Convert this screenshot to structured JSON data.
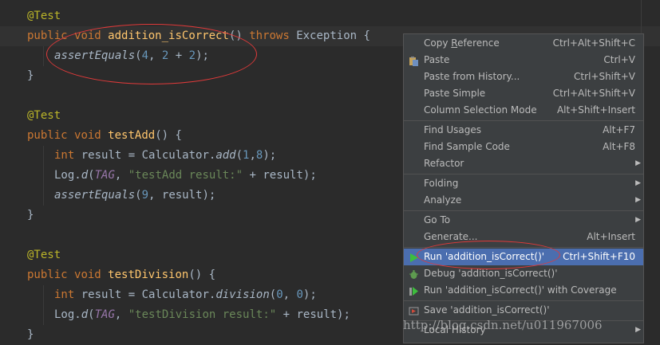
{
  "editor": {
    "lines": [
      {
        "ann": "@Test"
      },
      {
        "kw1": "public",
        "kw2": "void",
        "name": "addition_isCorrect",
        "paren": "()",
        "throws": "throws",
        "exc": "Exception {"
      },
      {
        "call": "assertEquals",
        "open": "(",
        "n1": "4",
        "sep1": ", ",
        "n2": "2",
        "plus": " + ",
        "n3": "2",
        "close": ");"
      },
      {
        "text": "}"
      },
      {
        "ann": "@Test"
      },
      {
        "kw1": "public",
        "kw2": "void",
        "name": "testAdd",
        "rest": "() {"
      },
      {
        "type": "int",
        "pre": "result = Calculator.",
        "call": "add",
        "open": "(",
        "n1": "1",
        "sep": ",",
        "n2": "8",
        "close": ");"
      },
      {
        "pre": "Log.",
        "call": "d",
        "open": "(",
        "const": "TAG",
        "sep": ", ",
        "str": "\"testAdd result:\"",
        "rest": " + result);"
      },
      {
        "call": "assertEquals",
        "open": "(",
        "n1": "9",
        "rest": ", result);"
      },
      {
        "text": "}"
      },
      {
        "ann": "@Test"
      },
      {
        "kw1": "public",
        "kw2": "void",
        "name": "testDivision",
        "rest": "() {"
      },
      {
        "type": "int",
        "pre": "result = Calculator.",
        "call": "division",
        "open": "(",
        "n1": "0",
        "sep": ", ",
        "n2": "0",
        "close": ");"
      },
      {
        "pre": "Log.",
        "call": "d",
        "open": "(",
        "const": "TAG",
        "sep": ", ",
        "str": "\"testDivision result:\"",
        "rest": " + result);"
      },
      {
        "text": "}"
      }
    ]
  },
  "context_menu": {
    "copy_reference": {
      "label": "Copy Reference",
      "shortcut": "Ctrl+Alt+Shift+C"
    },
    "paste": {
      "label": "Paste",
      "shortcut": "Ctrl+V",
      "icon": "paste-icon"
    },
    "paste_history": {
      "label": "Paste from History...",
      "shortcut": "Ctrl+Shift+V"
    },
    "paste_simple": {
      "label": "Paste Simple",
      "shortcut": "Ctrl+Alt+Shift+V"
    },
    "column_selection": {
      "label": "Column Selection Mode",
      "shortcut": "Alt+Shift+Insert"
    },
    "find_usages": {
      "label": "Find Usages",
      "shortcut": "Alt+F7"
    },
    "find_sample": {
      "label": "Find Sample Code",
      "shortcut": "Alt+F8"
    },
    "refactor": {
      "label": "Refactor"
    },
    "folding": {
      "label": "Folding"
    },
    "analyze": {
      "label": "Analyze"
    },
    "go_to": {
      "label": "Go To"
    },
    "generate": {
      "label": "Generate...",
      "shortcut": "Alt+Insert"
    },
    "run": {
      "label": "Run 'addition_isCorrect()'",
      "shortcut": "Ctrl+Shift+F10",
      "icon": "run-icon"
    },
    "debug": {
      "label": "Debug 'addition_isCorrect()'",
      "icon": "debug-icon"
    },
    "coverage": {
      "label": "Run 'addition_isCorrect()' with Coverage",
      "icon": "coverage-icon"
    },
    "save": {
      "label": "Save 'addition_isCorrect()'",
      "icon": "save-config-icon"
    },
    "local_history": {
      "label": "Local History"
    }
  },
  "watermark": "http://blog.csdn.net/u011967006",
  "colors": {
    "selection": "#4b6eaf",
    "menu_bg": "#3c3f41",
    "editor_bg": "#2b2b2b",
    "annotation_circle": "#e03a3a"
  }
}
